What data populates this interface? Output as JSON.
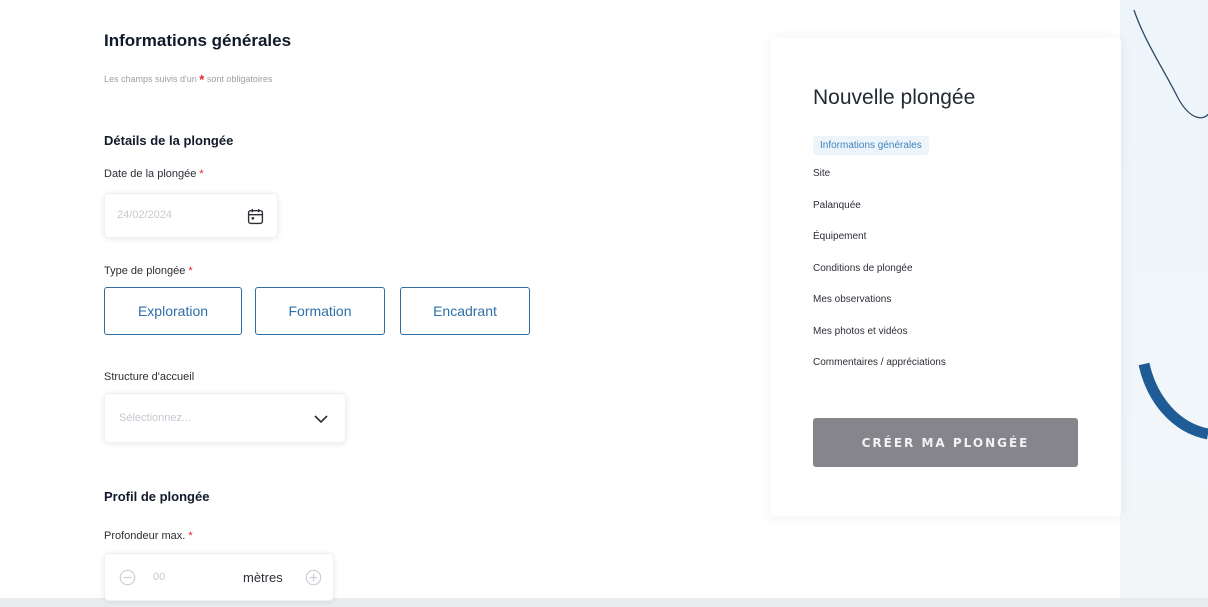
{
  "form": {
    "section_title": "Informations générales",
    "required_note_before": "Les champs suivis d'un",
    "required_star": "*",
    "required_note_after": "sont obligatoires",
    "dive_details_title": "Détails de la plongée",
    "date_label": "Date de la plongée",
    "date_value": "24/02/2024",
    "dive_type_label": "Type de plongée",
    "dive_types": [
      "Exploration",
      "Formation",
      "Encadrant"
    ],
    "structure_label": "Structure d'accueil",
    "structure_placeholder": "Sélectionnez...",
    "profile_title": "Profil de plongée",
    "max_depth_label": "Profondeur max.",
    "max_depth_value": "00",
    "max_depth_unit": "mètres"
  },
  "sidebar": {
    "title": "Nouvelle plongée",
    "steps": [
      "Informations générales",
      "Site",
      "Palanquée",
      "Équipement",
      "Conditions de plongée",
      "Mes observations",
      "Mes photos et vidéos",
      "Commentaires / appréciations"
    ],
    "active_step": 0,
    "create_button": "CRÉER MA PLONGÉE"
  },
  "colors": {
    "accent": "#2e6fa7",
    "required": "#e4252f",
    "active_step_bg": "#edf5fb",
    "create_button_bg": "#85858b"
  },
  "icons": [
    "calendar-icon",
    "chevron-down-icon",
    "minus-circle-icon",
    "plus-circle-icon"
  ]
}
